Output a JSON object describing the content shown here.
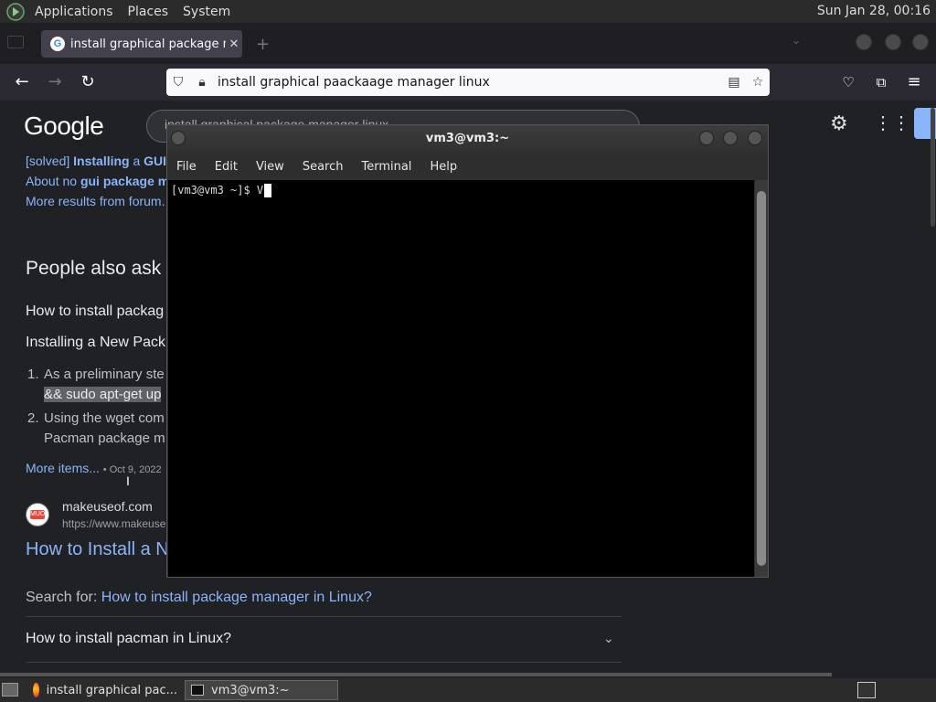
{
  "top_panel": {
    "menus": [
      "Applications",
      "Places",
      "System"
    ],
    "clock": "Sun Jan 28, 00:16"
  },
  "browser": {
    "tab_title": "install graphical package ma",
    "tab_close": "✕",
    "new_tab": "+",
    "url": "install graphical paackaage manager linux",
    "icons": [
      "back-icon",
      "forward-icon",
      "reload-icon",
      "shield-icon",
      "lock-icon",
      "reader-icon",
      "star-icon",
      "pocket-icon",
      "extensions-icon",
      "menu-icon"
    ]
  },
  "google": {
    "logo": "Google",
    "search_text": "install graphical package manager linux",
    "results_top": {
      "line1_prefix": "[solved] ",
      "line1_bold": "Installing",
      "line1_mid": " a ",
      "line1_bold2": "GUI",
      "line2_prefix": "About no ",
      "line2_bold": "gui package m",
      "line3": "More results from forum."
    },
    "paa_heading": "People also ask",
    "paa_q1": "How to install packag",
    "snippet_title": "Installing a New Pack",
    "list": [
      {
        "num": "1.",
        "line1": "As a preliminary ste",
        "line2": "&& sudo apt-get up"
      },
      {
        "num": "2.",
        "line1": "Using the wget com",
        "line2": "Pacman package m"
      }
    ],
    "more_items": "More items...",
    "more_date": "Oct 9, 2022",
    "source_name": "makeuseof.com",
    "source_url": "https://www.makeuse",
    "source_title": "How to Install a N",
    "search_for_label": "Search for: ",
    "search_for_link": "How to install package manager in Linux?",
    "paa_q2": "How to install pacman in Linux?"
  },
  "terminal": {
    "title": "vm3@vm3:~",
    "menu": [
      "File",
      "Edit",
      "View",
      "Search",
      "Terminal",
      "Help"
    ],
    "prompt": "[vm3@vm3 ~]$ V"
  },
  "taskbar": {
    "tasks": [
      "install graphical pac...",
      "vm3@vm3:~"
    ]
  }
}
